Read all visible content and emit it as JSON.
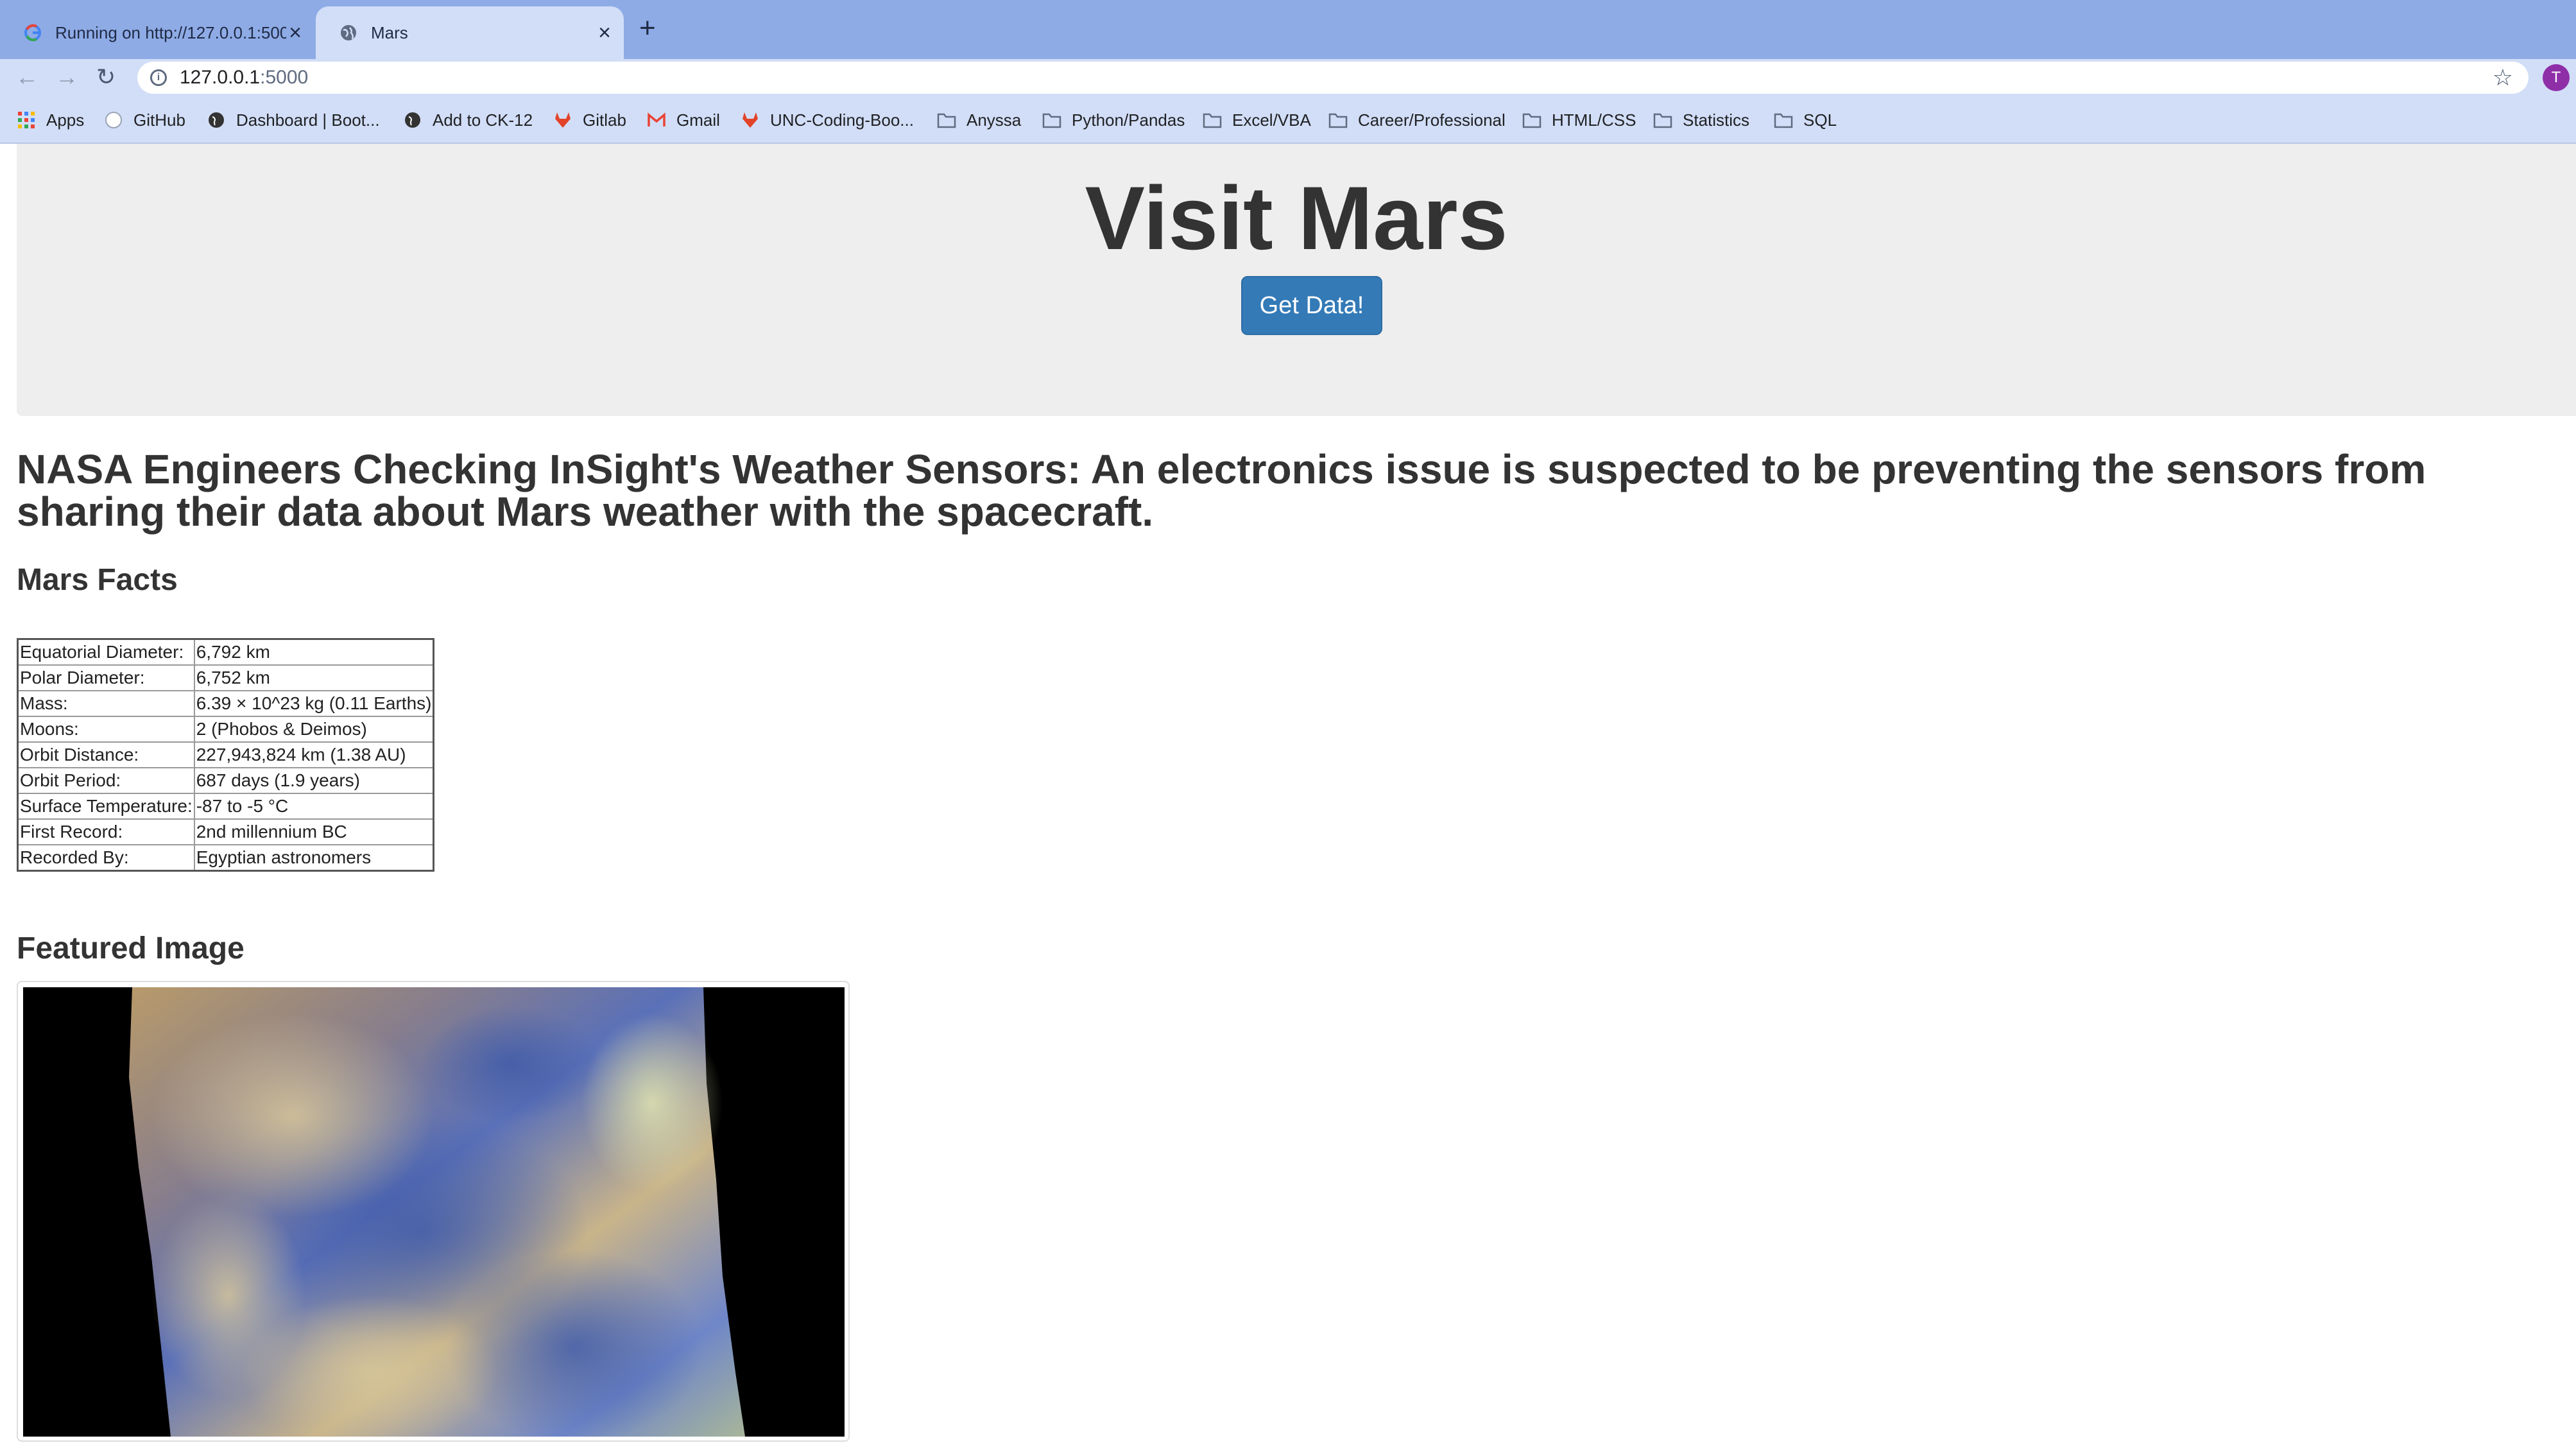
{
  "browser": {
    "tabs": [
      {
        "title": "Running on http://127.0.0.1:5000",
        "favicon": "google-icon"
      },
      {
        "title": "Mars",
        "favicon": "globe-icon"
      }
    ],
    "url_host": "127.0.0.1",
    "url_port": ":5000",
    "profile_initial": "T",
    "bookmarks": [
      {
        "label": "Apps",
        "icon": "apps-grid-icon"
      },
      {
        "label": "GitHub",
        "icon": "github-icon"
      },
      {
        "label": "Dashboard | Boot...",
        "icon": "globe-icon"
      },
      {
        "label": "Add to CK-12",
        "icon": "globe-icon"
      },
      {
        "label": "Gitlab",
        "icon": "gitlab-icon"
      },
      {
        "label": "Gmail",
        "icon": "gmail-icon"
      },
      {
        "label": "UNC-Coding-Boo...",
        "icon": "gitlab-icon"
      },
      {
        "label": "Anyssa",
        "icon": "folder-icon"
      },
      {
        "label": "Python/Pandas",
        "icon": "folder-icon"
      },
      {
        "label": "Excel/VBA",
        "icon": "folder-icon"
      },
      {
        "label": "Career/Professional",
        "icon": "folder-icon"
      },
      {
        "label": "HTML/CSS",
        "icon": "folder-icon"
      },
      {
        "label": "Statistics",
        "icon": "folder-icon"
      },
      {
        "label": "SQL",
        "icon": "folder-icon"
      }
    ]
  },
  "page": {
    "title": "Visit Mars",
    "button_label": "Get Data!",
    "news_title": "NASA Engineers Checking InSight's Weather Sensors: An electronics issue is suspected to be preventing the sensors from sharing their data about Mars weather with the spacecraft.",
    "facts_heading": "Mars Facts",
    "facts": [
      {
        "label": "Equatorial Diameter:",
        "value": "6,792 km"
      },
      {
        "label": "Polar Diameter:",
        "value": "6,752 km"
      },
      {
        "label": "Mass:",
        "value": "6.39 × 10^23 kg (0.11 Earths)"
      },
      {
        "label": "Moons:",
        "value": "2 (Phobos & Deimos)"
      },
      {
        "label": "Orbit Distance:",
        "value": "227,943,824 km (1.38 AU)"
      },
      {
        "label": "Orbit Period:",
        "value": "687 days (1.9 years)"
      },
      {
        "label": "Surface Temperature:",
        "value": "-87 to -5 °C"
      },
      {
        "label": "First Record:",
        "value": "2nd millennium BC"
      },
      {
        "label": "Recorded By:",
        "value": "Egyptian astronomers"
      }
    ],
    "featured_heading": "Featured Image",
    "colors": {
      "accent": "#337ab7",
      "jumbotron": "#eeeeee",
      "tabstrip": "#8eabe6",
      "toolbar": "#d2def7"
    }
  }
}
